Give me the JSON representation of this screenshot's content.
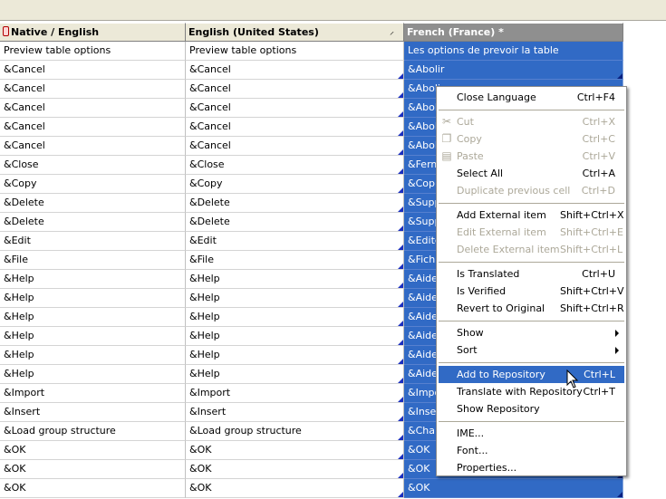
{
  "columns": [
    {
      "label": "Native / English"
    },
    {
      "label": "English (United States)",
      "sort_icon": "sort-up-icon"
    },
    {
      "label": "French (France) *"
    }
  ],
  "rows": [
    [
      "Preview table options",
      "Preview table options",
      "Les options de prevoir la table"
    ],
    [
      "&Cancel",
      "&Cancel",
      "&Abolir"
    ],
    [
      "&Cancel",
      "&Cancel",
      "&Aboli"
    ],
    [
      "&Cancel",
      "&Cancel",
      "&Aboli"
    ],
    [
      "&Cancel",
      "&Cancel",
      "&Aboli"
    ],
    [
      "&Cancel",
      "&Cancel",
      "&Aboli"
    ],
    [
      "&Close",
      "&Close",
      "&Ferm"
    ],
    [
      "&Copy",
      "&Copy",
      "&Copie"
    ],
    [
      "&Delete",
      "&Delete",
      "&Supp"
    ],
    [
      "&Delete",
      "&Delete",
      "&Supp"
    ],
    [
      "&Edit",
      "&Edit",
      "&Editer"
    ],
    [
      "&File",
      "&File",
      "&Fichie"
    ],
    [
      "&Help",
      "&Help",
      "&Aide"
    ],
    [
      "&Help",
      "&Help",
      "&Aide"
    ],
    [
      "&Help",
      "&Help",
      "&Aide"
    ],
    [
      "&Help",
      "&Help",
      "&Aide"
    ],
    [
      "&Help",
      "&Help",
      "&Aide"
    ],
    [
      "&Help",
      "&Help",
      "&Aide"
    ],
    [
      "&Import",
      "&Import",
      "&Impor"
    ],
    [
      "&Insert",
      "&Insert",
      "&Inser"
    ],
    [
      "&Load group structure",
      "&Load group structure",
      "&Charg"
    ],
    [
      "&OK",
      "&OK",
      "&OK"
    ],
    [
      "&OK",
      "&OK",
      "&OK"
    ],
    [
      "&OK",
      "&OK",
      "&OK"
    ]
  ],
  "context_menu": {
    "items": [
      {
        "label": "Close Language",
        "shortcut": "Ctrl+F4",
        "enabled": true
      },
      {
        "separator": true
      },
      {
        "label": "Cut",
        "shortcut": "Ctrl+X",
        "enabled": false,
        "icon": "scissors-icon"
      },
      {
        "label": "Copy",
        "shortcut": "Ctrl+C",
        "enabled": false,
        "icon": "copy-icon"
      },
      {
        "label": "Paste",
        "shortcut": "Ctrl+V",
        "enabled": false,
        "icon": "paste-icon"
      },
      {
        "label": "Select All",
        "shortcut": "Ctrl+A",
        "enabled": true
      },
      {
        "label": "Duplicate previous cell",
        "shortcut": "Ctrl+D",
        "enabled": false
      },
      {
        "separator": true
      },
      {
        "label": "Add External item",
        "shortcut": "Shift+Ctrl+X",
        "enabled": true
      },
      {
        "label": "Edit External item",
        "shortcut": "Shift+Ctrl+E",
        "enabled": false
      },
      {
        "label": "Delete External item",
        "shortcut": "Shift+Ctrl+L",
        "enabled": false
      },
      {
        "separator": true
      },
      {
        "label": "Is Translated",
        "shortcut": "Ctrl+U",
        "enabled": true
      },
      {
        "label": "Is Verified",
        "shortcut": "Shift+Ctrl+V",
        "enabled": true
      },
      {
        "label": "Revert to Original",
        "shortcut": "Shift+Ctrl+R",
        "enabled": true
      },
      {
        "separator": true
      },
      {
        "label": "Show",
        "submenu": true,
        "enabled": true
      },
      {
        "label": "Sort",
        "submenu": true,
        "enabled": true
      },
      {
        "separator": true
      },
      {
        "label": "Add to Repository",
        "shortcut": "Ctrl+L",
        "enabled": true,
        "highlighted": true
      },
      {
        "label": "Translate with Repository",
        "shortcut": "Ctrl+T",
        "enabled": true
      },
      {
        "label": "Show Repository",
        "enabled": true
      },
      {
        "separator": true
      },
      {
        "label": "IME...",
        "enabled": true
      },
      {
        "label": "Font...",
        "enabled": true
      },
      {
        "label": "Properties...",
        "enabled": true
      }
    ]
  },
  "colors": {
    "selection": "#316ac5",
    "menu_disabled": "#aca899",
    "header_bg": "#ece9d8",
    "header_selected": "#8f8f8f"
  }
}
